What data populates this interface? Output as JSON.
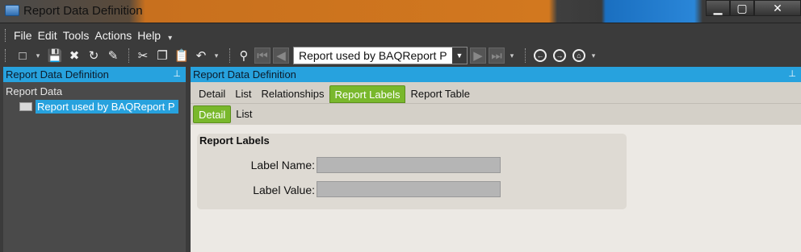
{
  "window": {
    "title": "Report Data Definition",
    "minimize": "▁",
    "maximize": "▢",
    "close": "✕"
  },
  "menu": [
    "File",
    "Edit",
    "Tools",
    "Actions",
    "Help"
  ],
  "toolbar": {
    "navigator_value": "Report used by BAQReport P"
  },
  "left_panel": {
    "header": "Report Data Definition",
    "tree_root": "Report Data",
    "tree_node": "Report used by BAQReport P"
  },
  "right_panel": {
    "header": "Report Data Definition",
    "tabs": [
      "Detail",
      "List",
      "Relationships",
      "Report Labels",
      "Report Table"
    ],
    "active_tab": "Report Labels",
    "subtabs": [
      "Detail",
      "List"
    ],
    "active_subtab": "Detail",
    "group_title": "Report Labels",
    "fields": [
      {
        "label": "Label Name:",
        "value": ""
      },
      {
        "label": "Label Value:",
        "value": ""
      }
    ]
  },
  "colors": {
    "header_blue": "#27a2de",
    "tab_green": "#79b82c"
  },
  "icons": [
    "new-icon",
    "save-icon",
    "delete-icon",
    "refresh-icon",
    "clear-icon",
    "cut-icon",
    "copy-icon",
    "paste-icon",
    "undo-icon",
    "search-icon",
    "first-record-icon",
    "previous-record-icon",
    "next-record-icon",
    "last-record-icon",
    "back-icon",
    "forward-icon",
    "home-icon",
    "pin-icon",
    "folder-icon"
  ]
}
